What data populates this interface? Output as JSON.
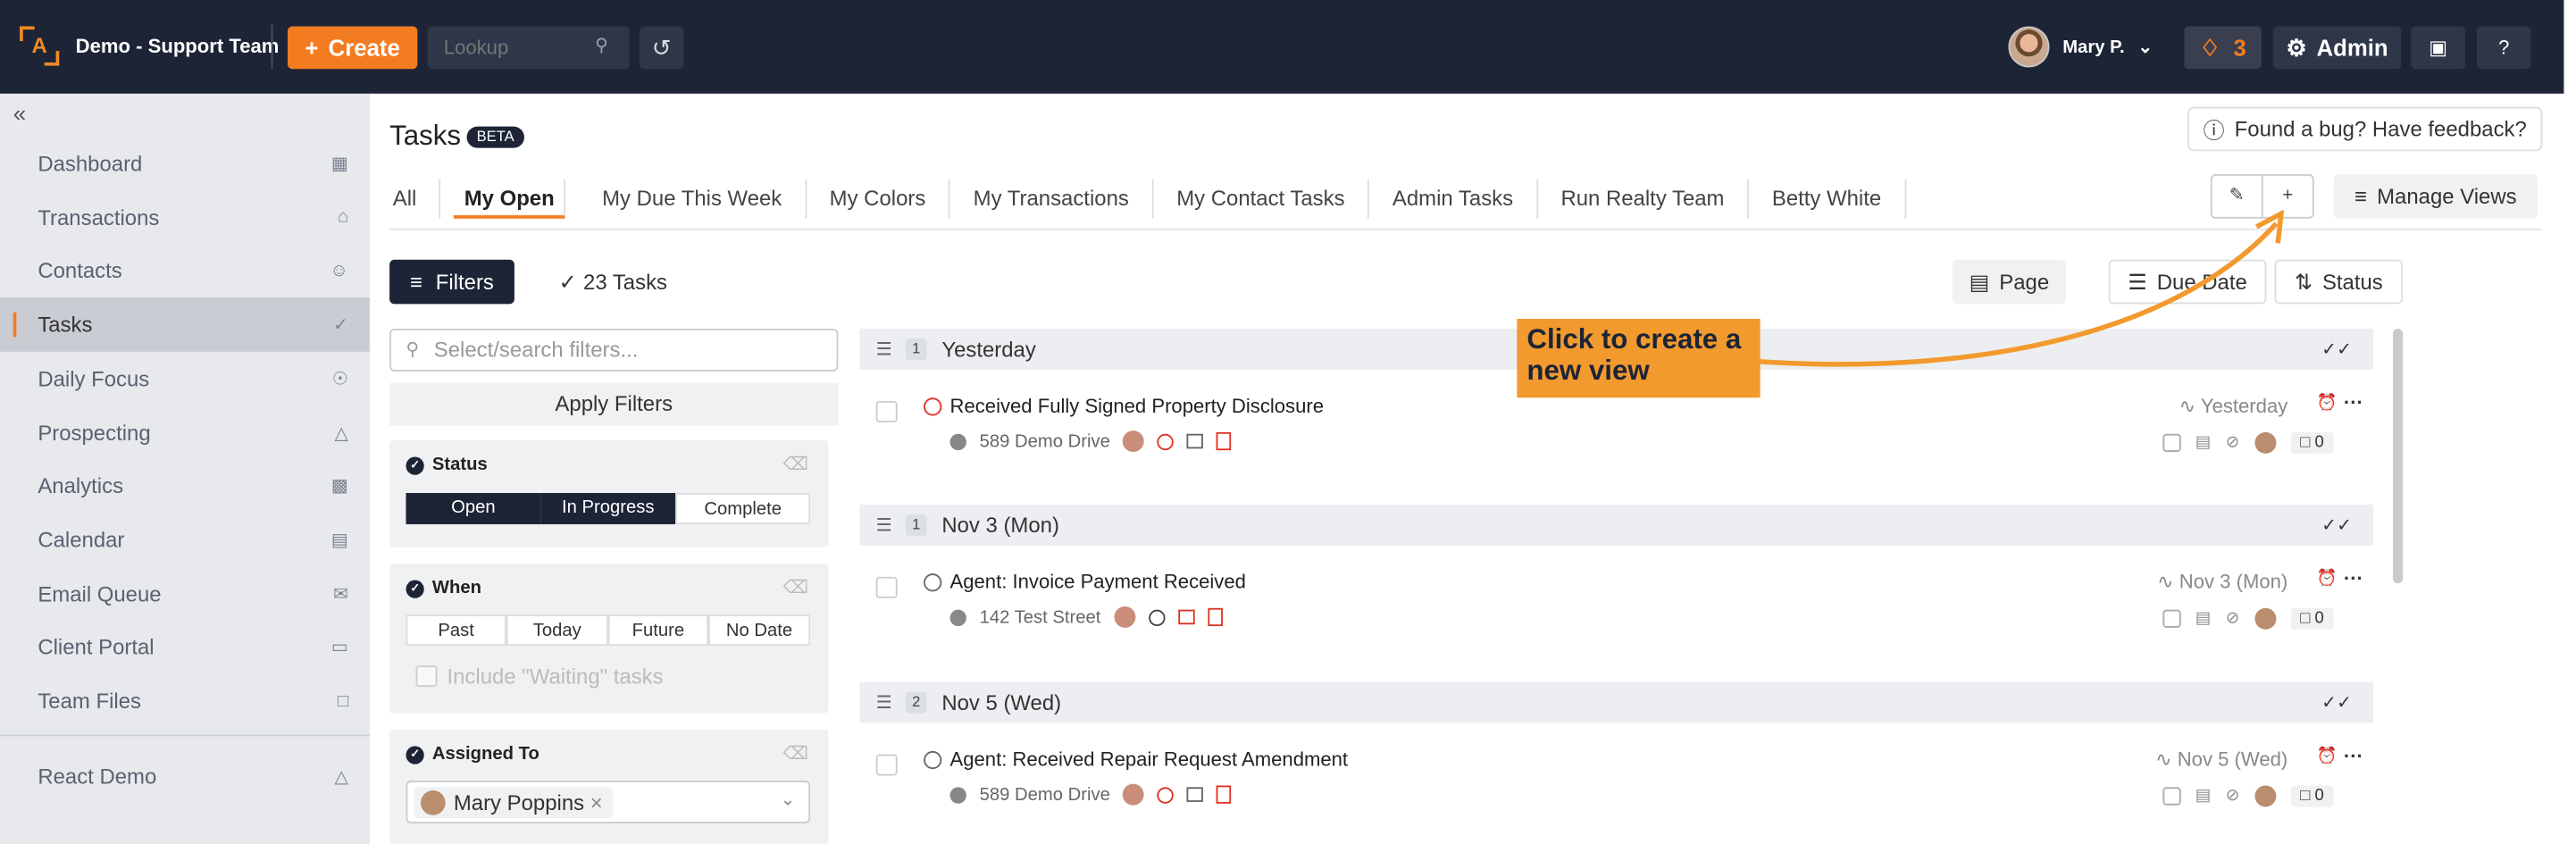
{
  "topbar": {
    "team": "Demo - Support Team",
    "create": "Create",
    "lookup_placeholder": "Lookup",
    "user": "Mary P.",
    "notif_count": "3",
    "admin": "Admin"
  },
  "sidebar": {
    "items": [
      {
        "label": "Dashboard",
        "icon": "dashboard-icon"
      },
      {
        "label": "Transactions",
        "icon": "home-icon"
      },
      {
        "label": "Contacts",
        "icon": "person-icon"
      },
      {
        "label": "Tasks",
        "icon": "check-circle-icon"
      },
      {
        "label": "Daily Focus",
        "icon": "target-icon"
      },
      {
        "label": "Prospecting",
        "icon": "prospect-icon"
      },
      {
        "label": "Analytics",
        "icon": "chart-icon"
      },
      {
        "label": "Calendar",
        "icon": "calendar-icon"
      },
      {
        "label": "Email Queue",
        "icon": "email-queue-icon"
      },
      {
        "label": "Client Portal",
        "icon": "portal-icon"
      },
      {
        "label": "Team Files",
        "icon": "file-icon"
      }
    ],
    "react_demo": "React Demo"
  },
  "page": {
    "title": "Tasks",
    "badge": "BETA",
    "feedback": "Found a bug? Have feedback?"
  },
  "tabs": [
    "All",
    "My Open",
    "My Due This Week",
    "My Colors",
    "My Transactions",
    "My Contact Tasks",
    "Admin Tasks",
    "Run Realty Team",
    "Betty White"
  ],
  "toolbar": {
    "filters": "Filters",
    "task_count": "23 Tasks",
    "page": "Page",
    "due_date": "Due Date",
    "status": "Status",
    "manage_views": "Manage Views"
  },
  "filters": {
    "search_placeholder": "Select/search filters...",
    "apply": "Apply Filters",
    "status": {
      "title": "Status",
      "options": [
        "Open",
        "In Progress",
        "Complete"
      ]
    },
    "when": {
      "title": "When",
      "options": [
        "Past",
        "Today",
        "Future",
        "No Date"
      ],
      "waiting": "Include \"Waiting\" tasks"
    },
    "assigned": {
      "title": "Assigned To",
      "value": "Mary Poppins"
    }
  },
  "groups": [
    {
      "count": "1",
      "label": "Yesterday",
      "task": {
        "title": "Received Fully Signed Property Disclosure",
        "address": "589 Demo Drive",
        "due": "Yesterday",
        "comments": "0"
      }
    },
    {
      "count": "1",
      "label": "Nov 3 (Mon)",
      "task": {
        "title": "Agent: Invoice Payment Received",
        "address": "142 Test Street",
        "due": "Nov 3 (Mon)",
        "comments": "0"
      }
    },
    {
      "count": "2",
      "label": "Nov 5 (Wed)",
      "task": {
        "title": "Agent: Received Repair Request Amendment",
        "address": "589 Demo Drive",
        "due": "Nov 5 (Wed)",
        "comments": "0"
      }
    }
  ],
  "callout": "Click to create a new view",
  "colors": {
    "accent": "#f47c20",
    "navy": "#1c2436",
    "callout": "#f29a2e"
  }
}
